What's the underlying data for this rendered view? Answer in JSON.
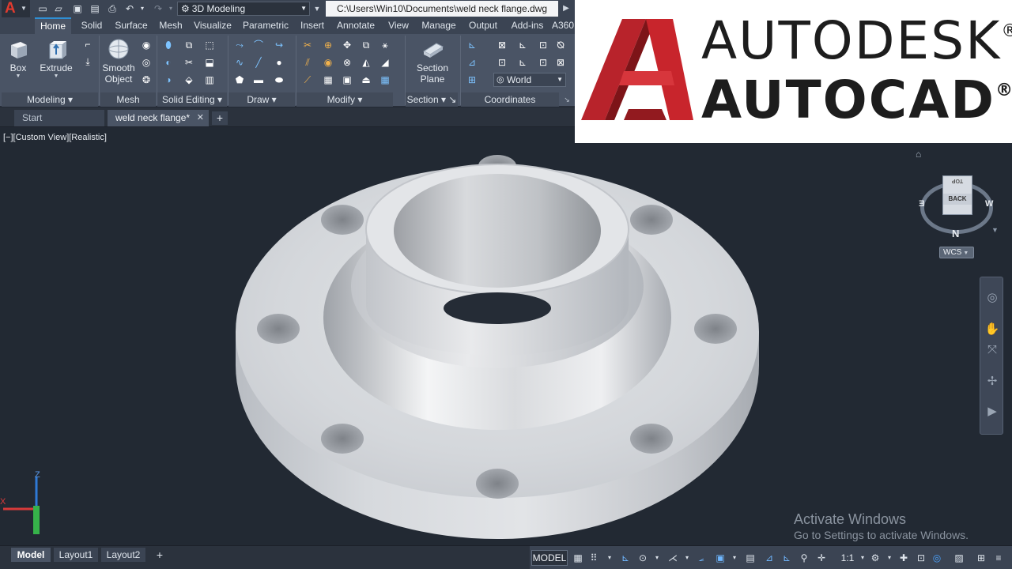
{
  "titlebar": {
    "workspace": "3D Modeling",
    "doc_path": "C:\\Users\\Win10\\Documents\\weld neck flange.dwg"
  },
  "ribbon_tabs": [
    "Home",
    "Solid",
    "Surface",
    "Mesh",
    "Visualize",
    "Parametric",
    "Insert",
    "Annotate",
    "View",
    "Manage",
    "Output",
    "Add-ins",
    "A360"
  ],
  "ribbon": {
    "box_label": "Box",
    "extrude_label": "Extrude",
    "smooth_object_line1": "Smooth",
    "smooth_object_line2": "Object",
    "section_plane_line1": "Section",
    "section_plane_line2": "Plane",
    "ucs_select": "World",
    "panels": [
      "Modeling",
      "Mesh",
      "Solid Editing",
      "Draw",
      "Modify",
      "Section",
      "Coordinates"
    ]
  },
  "file_tabs": {
    "start": "Start",
    "active": "weld neck flange*"
  },
  "viewport": {
    "view_label": "[−][Custom View][Realistic]"
  },
  "viewcube": {
    "top": "TOP",
    "back": "BACK",
    "west": "W",
    "east": "E",
    "north": "N",
    "wcs": "WCS"
  },
  "ucs": {
    "z": "Z",
    "x": "X"
  },
  "watermark": {
    "title": "Activate Windows",
    "subtitle": "Go to Settings to activate Windows."
  },
  "layout_tabs": [
    "Model",
    "Layout1",
    "Layout2"
  ],
  "statusbar": {
    "model": "MODEL",
    "scale": "1:1"
  },
  "brand": {
    "line1": "AUTODESK",
    "line2": "AUTOCAD",
    "reg": "®"
  },
  "colors": {
    "brand_red": "#c8252c",
    "accent_blue": "#2f8fd4",
    "viewport_bg": "#222933"
  }
}
